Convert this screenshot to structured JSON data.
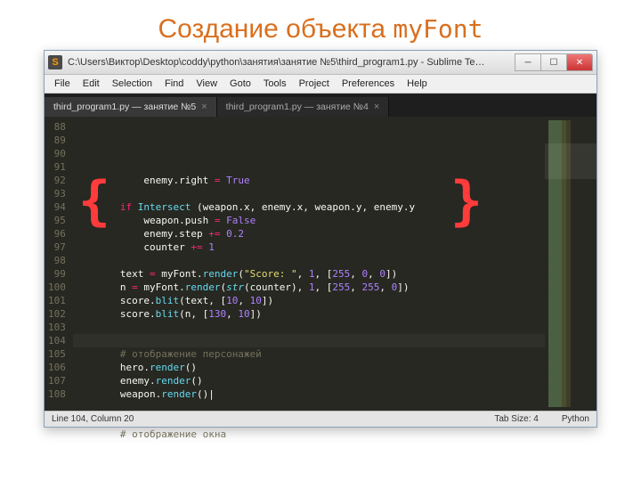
{
  "slide": {
    "title": "Создание объекта",
    "mono": "myFont"
  },
  "titlebar": {
    "app_letter": "S",
    "text": "C:\\Users\\Виктор\\Desktop\\coddy\\python\\занятия\\занятие №5\\third_program1.py - Sublime Te…"
  },
  "menu": [
    "File",
    "Edit",
    "Selection",
    "Find",
    "View",
    "Goto",
    "Tools",
    "Project",
    "Preferences",
    "Help"
  ],
  "tabs": [
    {
      "label": "third_program1.py — занятие №5",
      "active": true
    },
    {
      "label": "third_program1.py — занятие №4",
      "active": false
    }
  ],
  "gutter": [
    "88",
    "89",
    "90",
    "91",
    "92",
    "93",
    "94",
    "95",
    "96",
    "97",
    "98",
    "99",
    "100",
    "101",
    "102",
    "103",
    "104",
    "105",
    "106",
    "107",
    "108"
  ],
  "code": {
    "l88": {
      "indent": "            ",
      "a": "enemy",
      "b": "right",
      "c": "True"
    },
    "l90": {
      "indent": "        ",
      "kw": "if",
      "fn": "Intersect",
      "args": [
        "weapon",
        "x",
        "enemy",
        "x",
        "weapon",
        "y",
        "enemy",
        "y"
      ]
    },
    "l91": {
      "indent": "            ",
      "a": "weapon",
      "b": "push",
      "c": "False"
    },
    "l92": {
      "indent": "            ",
      "a": "enemy",
      "b": "step",
      "op": "+=",
      "n": "0.2"
    },
    "l93": {
      "indent": "            ",
      "a": "counter",
      "op": "+=",
      "n": "1"
    },
    "l95": {
      "indent": "        ",
      "v": "text",
      "o": "myFont",
      "m": "render",
      "s": "\"Score: \"",
      "n1": "1",
      "arr": [
        "255",
        "0",
        "0"
      ]
    },
    "l96": {
      "indent": "        ",
      "v": "n",
      "o": "myFont",
      "m": "render",
      "bif": "str",
      "arg": "counter",
      "n1": "1",
      "arr": [
        "255",
        "255",
        "0"
      ]
    },
    "l97": {
      "indent": "        ",
      "o": "score",
      "m": "blit",
      "a1": "text",
      "arr": [
        "10",
        "10"
      ]
    },
    "l98": {
      "indent": "        ",
      "o": "score",
      "m": "blit",
      "a1": "n",
      "arr": [
        "130",
        "10"
      ]
    },
    "l101": {
      "indent": "        ",
      "c": "# отображение персонажей"
    },
    "l102": {
      "indent": "        ",
      "o": "hero",
      "m": "render"
    },
    "l103": {
      "indent": "        ",
      "o": "enemy",
      "m": "render"
    },
    "l104": {
      "indent": "        ",
      "o": "weapon",
      "m": "render"
    },
    "l107": {
      "indent": "        ",
      "c": "# отображение окна"
    }
  },
  "status": {
    "left": "Line 104, Column 20",
    "tab": "Tab Size: 4",
    "lang": "Python"
  }
}
